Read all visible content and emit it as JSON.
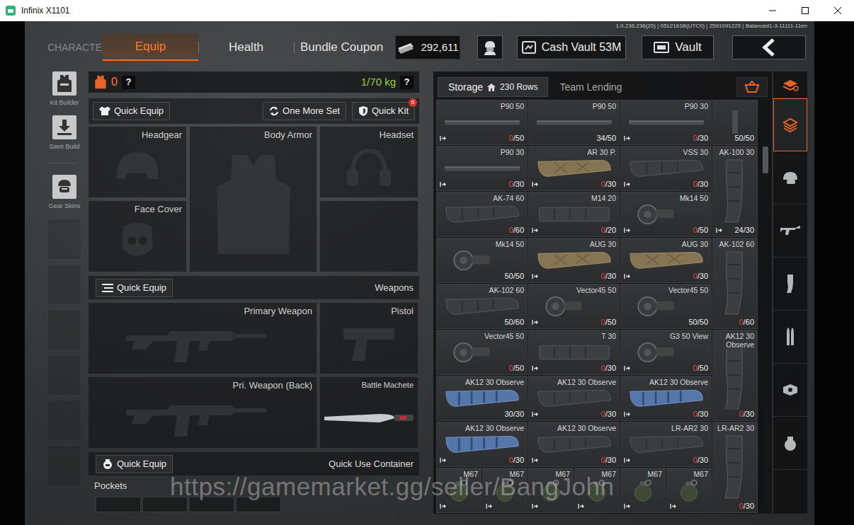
{
  "window": {
    "title": "Infinix X1101"
  },
  "build_info": "1.0.236.236(20) | 0512161B(UTC0) | 2591091225 | Balanced1-3-11111-11en",
  "nav": {
    "section": "CHARACTER",
    "tabs": [
      {
        "label": "Equip",
        "selected": true
      },
      {
        "label": "Health",
        "selected": false
      },
      {
        "label": "Bundle Coupon",
        "selected": false
      }
    ],
    "money": "292,611",
    "cash_vault": "Cash Vault 53M",
    "vault": "Vault"
  },
  "left_rail": [
    {
      "label": "Kit Builder",
      "kind": "kit"
    },
    {
      "label": "Save Build",
      "kind": "save"
    },
    {
      "label": "Gear Skins",
      "kind": "skins"
    }
  ],
  "equip": {
    "armor_count": "0",
    "armor_help": "?",
    "weight": "1/70 kg",
    "weight_help": "?",
    "actions": {
      "quick_equip": "Quick Equip",
      "one_more_set": "One More Set",
      "quick_kit": "Quick Kit",
      "quick_kit_badge": "5"
    },
    "gear_slots": [
      {
        "label": "Headgear",
        "kind": "headgear"
      },
      {
        "label": "Body Armor",
        "kind": "armor"
      },
      {
        "label": "Headset",
        "kind": "headset"
      },
      {
        "label": "Face Cover",
        "kind": "face"
      },
      {
        "kind": "blank"
      }
    ],
    "weapons": {
      "quick_equip": "Quick Equip",
      "title": "Weapons",
      "slots": [
        {
          "label": "Primary Weapon",
          "kind": "rifle",
          "filled": false
        },
        {
          "label": "Pistol",
          "kind": "pistol",
          "filled": false
        },
        {
          "label": "Pri. Weapon (Back)",
          "kind": "rifle",
          "filled": false
        },
        {
          "label": "Battle Machete",
          "kind": "machete",
          "filled": true
        }
      ]
    },
    "quick_use": {
      "quick_equip": "Quick Equip",
      "title": "Quick Use Container"
    },
    "pockets": {
      "label": "Pockets",
      "slots": [
        {
          "filled": false
        },
        {
          "filled": false
        },
        {
          "filled": false
        },
        {
          "filled": false
        }
      ]
    }
  },
  "storage": {
    "tabs": [
      {
        "label": "Storage",
        "rows": "230 Rows",
        "selected": true
      },
      {
        "label": "Team Lending",
        "selected": false
      }
    ],
    "scroll_position": 0.12,
    "items": [
      {
        "name": "P90 50",
        "kind": "stick",
        "count": "0",
        "capacity": "/50",
        "empty": true,
        "marked": true
      },
      {
        "name": "P90 50",
        "kind": "stick",
        "count": "34",
        "capacity": "/50",
        "empty": false,
        "marked": false
      },
      {
        "name": "P90 30",
        "kind": "stick",
        "count": "0",
        "capacity": "/30",
        "empty": true,
        "marked": true
      },
      {
        "kind": "tall-cut",
        "count": "50",
        "capacity": "/50",
        "empty": false,
        "marked": false
      },
      {
        "name": "P90 30",
        "kind": "stick",
        "count": "0",
        "capacity": "/30",
        "empty": true,
        "marked": true
      },
      {
        "name": "AR 30 P.",
        "kind": "tan",
        "count": "0",
        "capacity": "/30",
        "empty": true,
        "marked": true
      },
      {
        "name": "VSS 30",
        "kind": "box",
        "count": "0",
        "capacity": "/30",
        "empty": true,
        "marked": true
      },
      {
        "name": "AK-100 30",
        "kind": "tall",
        "count": "24",
        "capacity": "/30",
        "empty": false,
        "marked": true
      },
      {
        "name": "AK-74 60",
        "kind": "box",
        "count": "0",
        "capacity": "/60",
        "empty": true,
        "marked": false
      },
      {
        "name": "M14 20",
        "kind": "straight",
        "count": "0",
        "capacity": "/20",
        "empty": true,
        "marked": true
      },
      {
        "name": "Mk14 50",
        "kind": "drum",
        "count": "0",
        "capacity": "/50",
        "empty": true,
        "marked": true
      },
      {
        "name": "Mk14 50",
        "kind": "drum",
        "count": "50",
        "capacity": "/50",
        "empty": false,
        "marked": false
      },
      {
        "name": "AUG 30",
        "kind": "tan",
        "count": "0",
        "capacity": "/30",
        "empty": true,
        "marked": true
      },
      {
        "name": "AUG 30",
        "kind": "tan",
        "count": "0",
        "capacity": "/30",
        "empty": true,
        "marked": true
      },
      {
        "name": "AK-102 60",
        "kind": "tall",
        "count": "0",
        "capacity": "/60",
        "empty": true,
        "marked": false
      },
      {
        "name": "AK-102 60",
        "kind": "box",
        "count": "50",
        "capacity": "/60",
        "empty": false,
        "marked": false
      },
      {
        "name": "Vector45 50",
        "kind": "drum",
        "count": "0",
        "capacity": "/50",
        "empty": true,
        "marked": true
      },
      {
        "name": "Vector45 50",
        "kind": "drum",
        "count": "50",
        "capacity": "/50",
        "empty": false,
        "marked": false
      },
      {
        "name": "Vector45 50",
        "kind": "drum",
        "count": "0",
        "capacity": "/50",
        "empty": true,
        "marked": false
      },
      {
        "name": "T 30",
        "kind": "straight",
        "count": "0",
        "capacity": "/30",
        "empty": true,
        "marked": true
      },
      {
        "name": "G3 50 View",
        "kind": "drum",
        "count": "0",
        "capacity": "/50",
        "empty": true,
        "marked": true
      },
      {
        "name": "AK12 30 Observe",
        "kind": "tall",
        "count": "0",
        "capacity": "/30",
        "empty": true,
        "marked": false
      },
      {
        "name": "AK12 30 Observe",
        "kind": "blue",
        "count": "30",
        "capacity": "/30",
        "empty": false,
        "marked": false
      },
      {
        "name": "AK12 30 Observe",
        "kind": "box",
        "count": "0",
        "capacity": "/30",
        "empty": true,
        "marked": true
      },
      {
        "name": "AK12 30 Observe",
        "kind": "blue",
        "count": "0",
        "capacity": "/30",
        "empty": true,
        "marked": true
      },
      {
        "name": "AK12 30 Observe",
        "kind": "blue",
        "count": "0",
        "capacity": "/30",
        "empty": true,
        "marked": true
      },
      {
        "name": "AK12 30 Observe",
        "kind": "box",
        "count": "0",
        "capacity": "/30",
        "empty": true,
        "marked": true
      },
      {
        "name": "LR-AR2 30",
        "kind": "box",
        "count": "0",
        "capacity": "/30",
        "empty": true,
        "marked": true
      },
      {
        "name": "LR-AR2 30",
        "kind": "tall",
        "count": "0",
        "capacity": "/30",
        "empty": true,
        "marked": false
      },
      {
        "name": "M67",
        "kind": "grenade",
        "marked": true
      },
      {
        "name": "M67",
        "kind": "grenade",
        "marked": true
      },
      {
        "name": "M67",
        "kind": "grenade",
        "marked": true
      },
      {
        "name": "M67",
        "kind": "grenade",
        "marked": true
      },
      {
        "name": "M67",
        "kind": "grenade",
        "marked": true
      },
      {
        "name": "M67",
        "kind": "grenade",
        "marked": true
      }
    ]
  },
  "categories": [
    {
      "kind": "filter",
      "selected": false
    },
    {
      "kind": "all",
      "selected": true
    },
    {
      "kind": "helmet",
      "selected": false
    },
    {
      "kind": "rifle",
      "selected": false
    },
    {
      "kind": "mag",
      "selected": false
    },
    {
      "kind": "bullet",
      "selected": false
    },
    {
      "kind": "scope",
      "selected": false
    },
    {
      "kind": "grenade",
      "selected": false
    }
  ],
  "watermark": "https://gamemarket.gg/seller/BangJohn"
}
